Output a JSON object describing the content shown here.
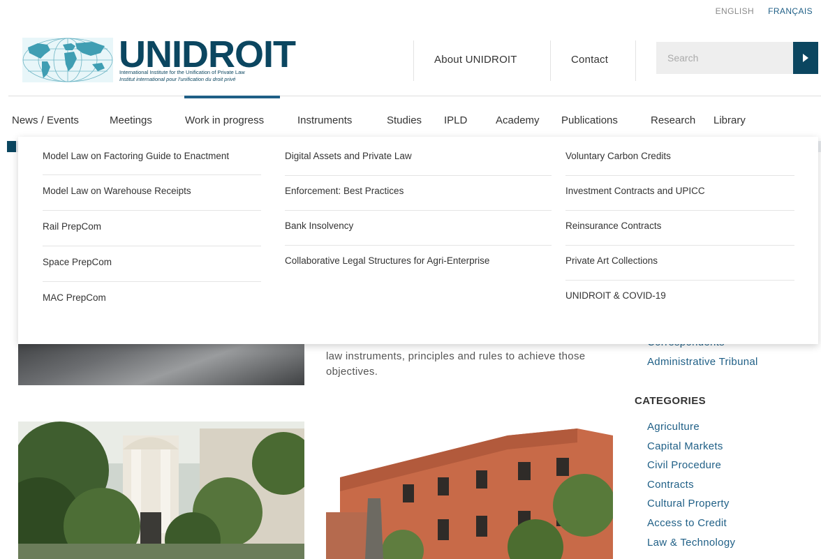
{
  "language": {
    "english": "ENGLISH",
    "francais": "FRANÇAIS"
  },
  "logo": {
    "wordmark": "UNIDROIT",
    "subtitle_en": "International Institute for the Unification of Private Law",
    "subtitle_fr": "Institut international pour l'unification du droit privé"
  },
  "header": {
    "about": "About UNIDROIT",
    "contact": "Contact"
  },
  "search": {
    "placeholder": "Search"
  },
  "nav": {
    "items": [
      "News / Events",
      "Meetings",
      "Work in progress",
      "Instruments",
      "Studies",
      "IPLD",
      "Academy",
      "Publications",
      "Research",
      "Library"
    ],
    "active": "Work in progress"
  },
  "dropdown": {
    "col1": [
      "Model Law on Factoring Guide to Enactment",
      "Model Law on Warehouse Receipts",
      "Rail PrepCom",
      "Space PrepCom",
      "MAC PrepCom"
    ],
    "col2": [
      "Digital Assets and Private Law",
      "Enforcement: Best Practices",
      "Bank Insolvency",
      "Collaborative Legal Structures for Agri-Enterprise"
    ],
    "col3": [
      "Voluntary Carbon Credits",
      "Investment Contracts and UPICC",
      "Reinsurance Contracts",
      "Private Art Collections",
      "UNIDROIT & COVID-19"
    ]
  },
  "content": {
    "body_text": "law instruments, principles and rules to achieve those objectives.",
    "side_links": [
      "Correspondents",
      "Administrative Tribunal"
    ],
    "categories_title": "CATEGORIES",
    "categories": [
      "Agriculture",
      "Capital Markets",
      "Civil Procedure",
      "Contracts",
      "Cultural Property",
      "Access to Credit",
      "Law & Technology"
    ]
  },
  "colors": {
    "brand": "#0b4660",
    "link": "#1f5f86"
  }
}
